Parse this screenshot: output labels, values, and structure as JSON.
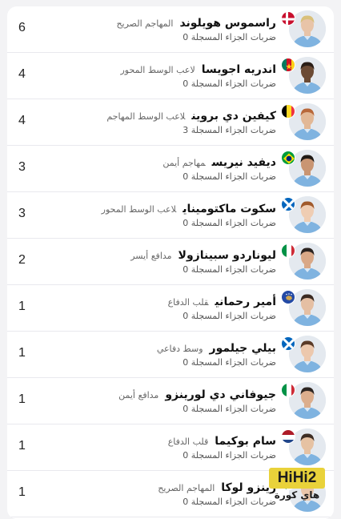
{
  "players": [
    {
      "name": "راسموس هويلوند",
      "position": "المهاجم الصريح",
      "stat_label": "ضربات الجزاء المسجلة",
      "stat_value": "0",
      "count": "6",
      "flag": "denmark-flag-icon"
    },
    {
      "name": "اندريه اجويسا",
      "position": "لاعب الوسط المحور",
      "stat_label": "ضربات الجزاء المسجلة",
      "stat_value": "0",
      "count": "4",
      "flag": "cameroon-flag-icon"
    },
    {
      "name": "كيفين دي بروين",
      "position": "لاعب الوسط المهاجم",
      "stat_label": "ضربات الجزاء المسجلة",
      "stat_value": "3",
      "count": "4",
      "flag": "belgium-flag-icon"
    },
    {
      "name": "ديفيد نيريس",
      "position": "مهاجم أيمن",
      "stat_label": "ضربات الجزاء المسجلة",
      "stat_value": "0",
      "count": "3",
      "flag": "brazil-flag-icon"
    },
    {
      "name": "سكوت ماكتوميناي",
      "position": "لاعب الوسط المحور",
      "stat_label": "ضربات الجزاء المسجلة",
      "stat_value": "0",
      "count": "3",
      "flag": "scotland-flag-icon"
    },
    {
      "name": "ليوناردو سبينازولا",
      "position": "مدافع أيسر",
      "stat_label": "ضربات الجزاء المسجلة",
      "stat_value": "0",
      "count": "2",
      "flag": "italy-flag-icon"
    },
    {
      "name": "أمير رحماني",
      "position": "قلب الدفاع",
      "stat_label": "ضربات الجزاء المسجلة",
      "stat_value": "0",
      "count": "1",
      "flag": "kosovo-flag-icon"
    },
    {
      "name": "بيلي جيلمور",
      "position": "وسط دفاعي",
      "stat_label": "ضربات الجزاء المسجلة",
      "stat_value": "0",
      "count": "1",
      "flag": "scotland-flag-icon"
    },
    {
      "name": "جيوفاني دي لورينزو",
      "position": "مدافع أيمن",
      "stat_label": "ضربات الجزاء المسجلة",
      "stat_value": "0",
      "count": "1",
      "flag": "italy-flag-icon"
    },
    {
      "name": "سام بوكيما",
      "position": "قلب الدفاع",
      "stat_label": "ضربات الجزاء المسجلة",
      "stat_value": "0",
      "count": "1",
      "flag": "netherlands-flag-icon"
    },
    {
      "name": "رينزو لوكا",
      "position": "المهاجم الصريح",
      "stat_label": "ضربات الجزاء المسجلة",
      "stat_value": "0",
      "count": "1",
      "flag": "italy-flag-icon"
    }
  ],
  "watermark": {
    "logo_text": "HiHi2",
    "sub_text": "هاي كورة"
  },
  "colors": {
    "jersey": "#7fb3e0",
    "divider": "#e9e9ee",
    "watermark": "#e9d23a"
  }
}
